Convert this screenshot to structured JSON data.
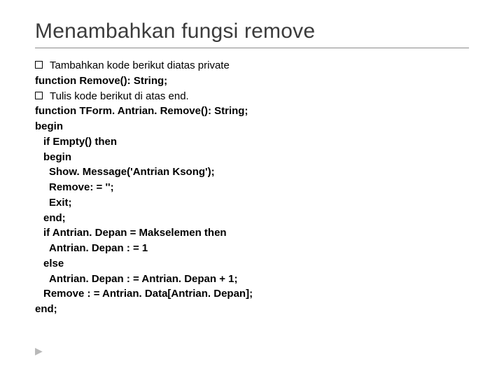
{
  "title": "Menambahkan fungsi remove",
  "bullets": [
    {
      "text": "Tambahkan kode berikut diatas private",
      "bold": false
    },
    {
      "text": "Tulis kode berikut di atas end.",
      "bold": false
    }
  ],
  "lines": {
    "l1": "function Remove(): String;",
    "l2": "function TForm. Antrian. Remove(): String;",
    "l3": "begin",
    "l4": "if Empty() then",
    "l5": "begin",
    "l6": "Show. Message('Antrian Ksong');",
    "l7": "Remove: = '';",
    "l8": "Exit;",
    "l9": "end;",
    "l10": "if Antrian. Depan = Makselemen then",
    "l11": "Antrian. Depan : = 1",
    "l12": "else",
    "l13": "Antrian. Depan : = Antrian. Depan + 1;",
    "l14": "Remove : = Antrian. Data[Antrian. Depan];",
    "l15": "end;"
  },
  "footer_arrow": "▶"
}
